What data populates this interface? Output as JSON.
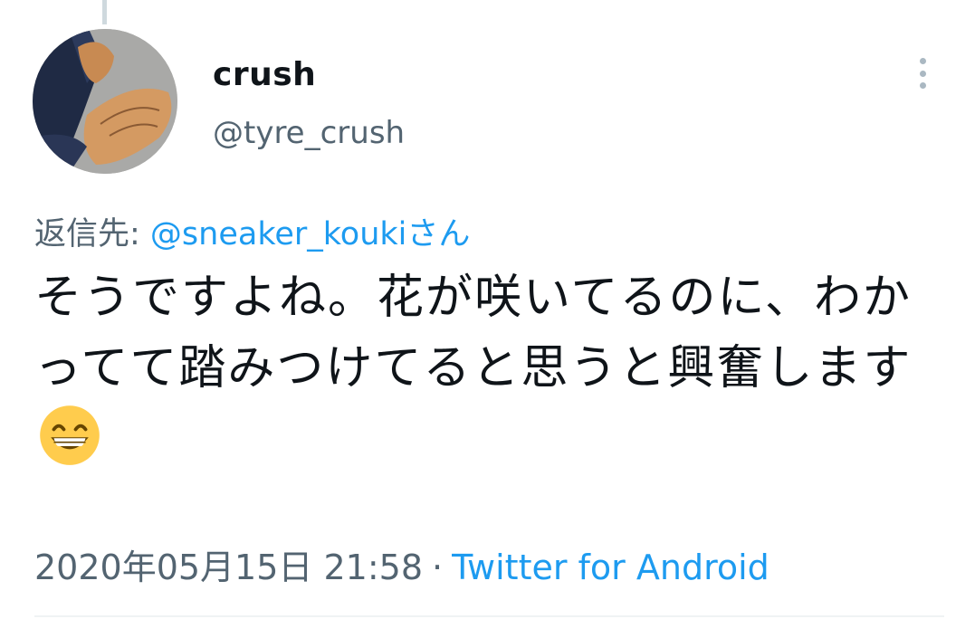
{
  "tweet": {
    "author": {
      "display_name": "crush",
      "handle": "@tyre_crush",
      "avatar_icon": "avatar-photo-shoes-icon"
    },
    "reply": {
      "prefix": "返信先: ",
      "mention": "@sneaker_kouki",
      "suffix": "さん"
    },
    "text": "そうですよね。花が咲いてるのに、わかってて踏みつけてると思うと興奮します",
    "emoji": "grinning-face-with-smiling-eyes-icon",
    "timestamp": "2020年05月15日 21:58",
    "separator": "·",
    "source": "Twitter for Android",
    "menu_icon": "more-vertical-icon"
  },
  "colors": {
    "text_primary": "#0f1419",
    "text_secondary": "#536471",
    "link": "#1d9bf0",
    "divider": "#eff3f4"
  }
}
